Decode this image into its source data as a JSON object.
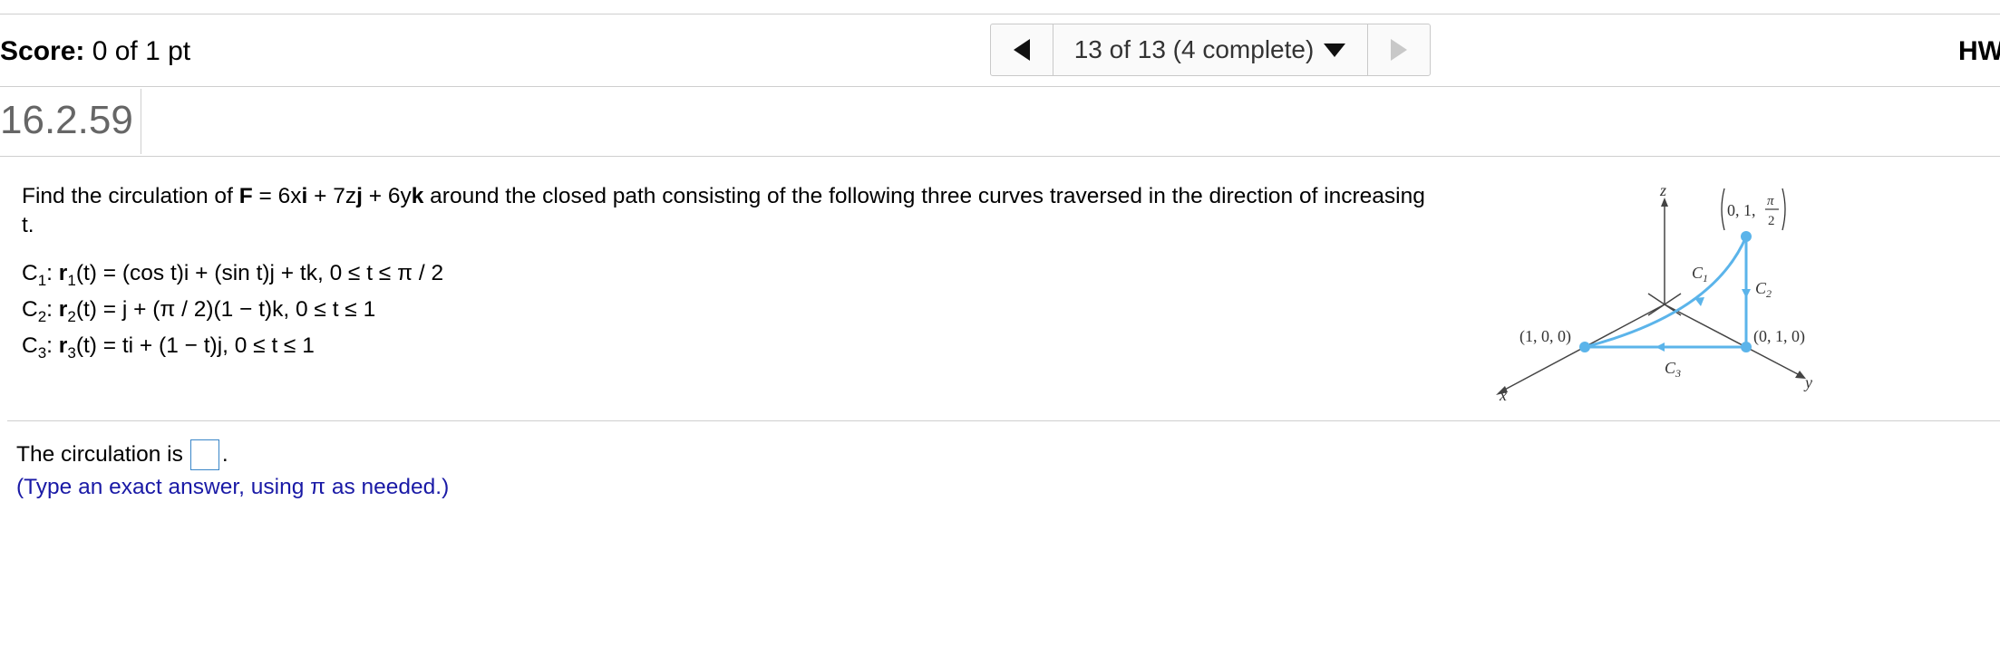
{
  "header": {
    "score_label": "Score:",
    "score_value": "0 of 1 pt",
    "nav_text": "13 of 13 (4 complete)",
    "hw_label": "HW"
  },
  "question": {
    "number": "16.2.59",
    "text_pre": "Find the circulation of ",
    "text_F": "F",
    "text_eq": " = 6x",
    "text_i": "i",
    "text_mid": " + 7z",
    "text_j": "j",
    "text_mid2": " + 6y",
    "text_k": "k",
    "text_post": " around the closed path consisting of the following three curves traversed in the direction of increasing t.",
    "curves": [
      {
        "name": "C",
        "sub": "1",
        "r": "r",
        "rsub": "1",
        "def": "(t) = (cos t)i + (sin t)j + tk, 0 ≤ t ≤ π / 2"
      },
      {
        "name": "C",
        "sub": "2",
        "r": "r",
        "rsub": "2",
        "def": "(t) = j + (π / 2)(1 − t)k, 0 ≤ t ≤ 1"
      },
      {
        "name": "C",
        "sub": "3",
        "r": "r",
        "rsub": "3",
        "def": "(t) = ti + (1 − t)j, 0 ≤ t ≤ 1"
      }
    ]
  },
  "figure": {
    "axis_z": "z",
    "axis_x": "x",
    "axis_y": "y",
    "point_top": "(0, 1, π/2)",
    "point_top_prefix": "0, 1,",
    "point_top_num": "π",
    "point_top_den": "2",
    "point_left": "(1, 0, 0)",
    "point_right": "(0, 1, 0)",
    "label_c1": "C",
    "label_c1_sub": "1",
    "label_c2": "C",
    "label_c2_sub": "2",
    "label_c3": "C",
    "label_c3_sub": "3",
    "curve_color": "#5bb4ea",
    "axis_color": "#444444"
  },
  "answer": {
    "prefix": "The circulation is",
    "suffix": ".",
    "hint": "(Type an exact answer, using π as needed.)"
  },
  "colors": {
    "hint": "#1a1aa6",
    "answer_box_border": "#3a86c8",
    "divider": "#cfcfcf"
  }
}
